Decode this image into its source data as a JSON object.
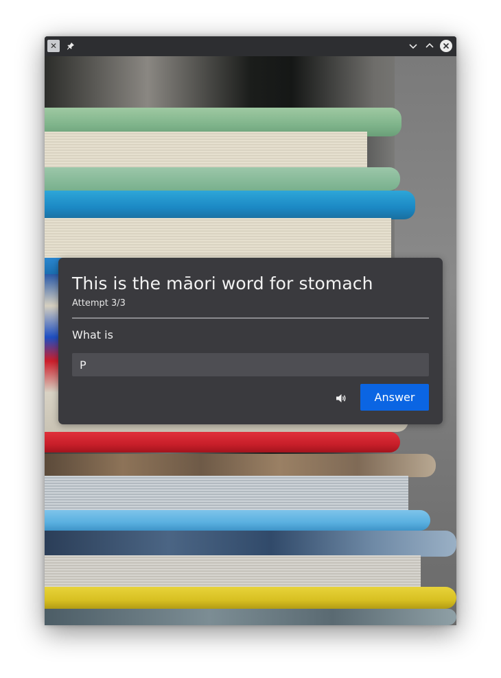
{
  "titlebar": {
    "app_icon": "app-icon",
    "pin_icon": "pin-icon",
    "minimize_icon": "chevron-down-icon",
    "maximize_icon": "chevron-up-icon",
    "close_icon": "close-icon"
  },
  "dialog": {
    "title": "This is the māori word for stomach",
    "attempt": "Attempt 3/3",
    "question": "What is",
    "input_value": "P",
    "speaker_icon": "speaker-icon",
    "answer_label": "Answer"
  },
  "colors": {
    "dialog_bg": "#3a3a3e",
    "input_bg": "#4e4e53",
    "accent": "#0b65e3",
    "titlebar_bg": "#2d2e31"
  }
}
